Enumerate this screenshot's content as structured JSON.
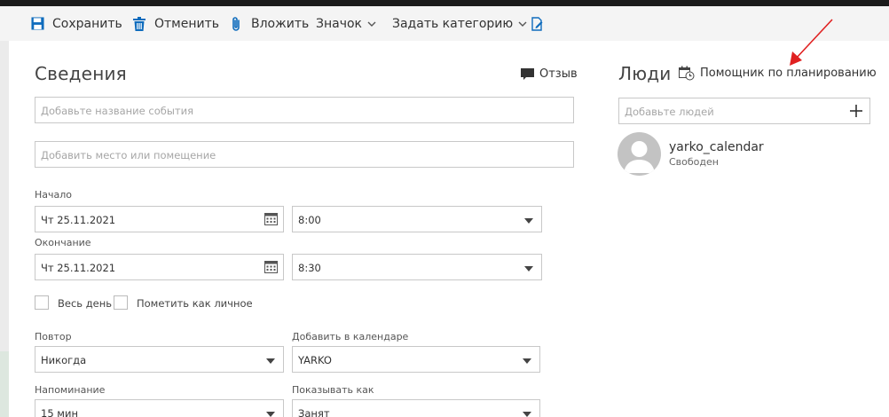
{
  "toolbar": {
    "save": "Сохранить",
    "cancel": "Отменить",
    "attach": "Вложить",
    "badge": "Значок",
    "category": "Задать категорию"
  },
  "details": {
    "title": "Сведения",
    "feedback": "Отзыв",
    "event_name_placeholder": "Добавьте название события",
    "location_placeholder": "Добавить место или помещение",
    "start_label": "Начало",
    "start_date": "Чт 25.11.2021",
    "start_time": "8:00",
    "end_label": "Окончание",
    "end_date": "Чт 25.11.2021",
    "end_time": "8:30",
    "all_day": "Весь день",
    "private": "Пометить как личное",
    "repeat_label": "Повтор",
    "repeat_value": "Никогда",
    "calendar_label": "Добавить в календаре",
    "calendar_value": "YARKO",
    "reminder_label": "Напоминание",
    "reminder_value": "15 мин",
    "show_as_label": "Показывать как",
    "show_as_value": "Занят"
  },
  "people": {
    "title": "Люди",
    "scheduling_assistant": "Помощник по планированию",
    "add_people_placeholder": "Добавьте людей",
    "attendees": [
      {
        "name": "yarko_calendar",
        "status": "Свободен"
      }
    ]
  },
  "colors": {
    "accent": "#0f6cbd",
    "arrow": "#e02020"
  }
}
